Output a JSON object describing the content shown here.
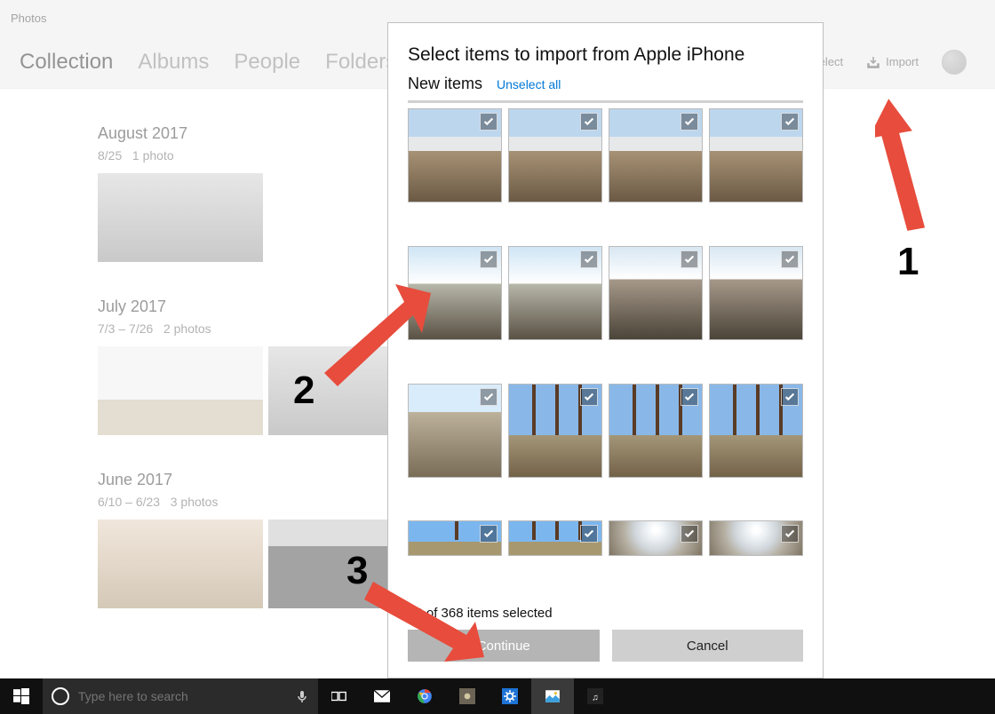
{
  "app": {
    "name": "Photos"
  },
  "nav": {
    "tabs": [
      "Collection",
      "Albums",
      "People",
      "Folders"
    ],
    "active": "Collection",
    "select_label": "Select",
    "import_label": "Import"
  },
  "groups": [
    {
      "title": "August 2017",
      "range": "8/25",
      "count_label": "1 photo"
    },
    {
      "title": "July 2017",
      "range": "7/3 – 7/26",
      "count_label": "2 photos"
    },
    {
      "title": "June 2017",
      "range": "6/10 – 6/23",
      "count_label": "3 photos"
    }
  ],
  "dialog": {
    "title": "Select items to import from Apple iPhone",
    "subtitle": "New items",
    "unselect_label": "Unselect all",
    "selected_label": "23 of 368 items selected",
    "continue_label": "Continue",
    "cancel_label": "Cancel"
  },
  "taskbar": {
    "search_placeholder": "Type here to search"
  },
  "annotations": {
    "n1": "1",
    "n2": "2",
    "n3": "3"
  }
}
